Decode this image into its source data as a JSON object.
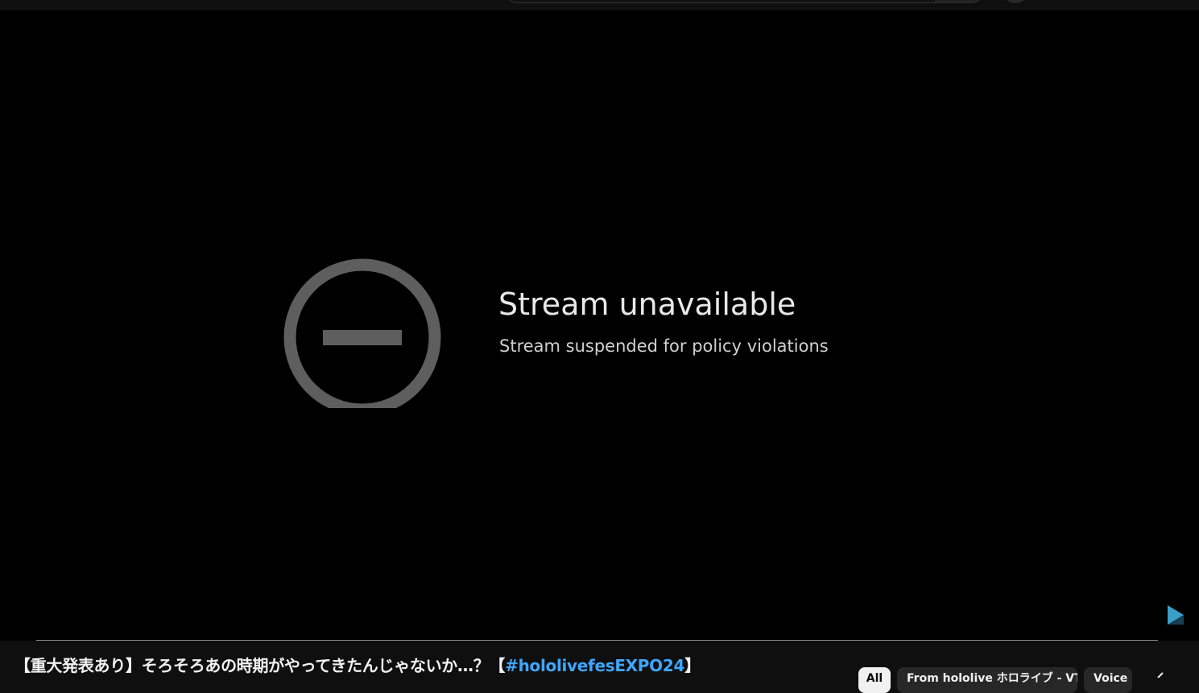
{
  "player": {
    "error_title": "Stream unavailable",
    "error_message": "Stream suspended for policy violations",
    "error_icon": "do-not-enter-icon"
  },
  "video": {
    "title_prefix": "【重大発表あり】そろそろあの時期がやってきたんじゃないか…？【",
    "title_hashtag": "#hololivefesEXPO24",
    "title_suffix": "】"
  },
  "chips": {
    "all": "All",
    "from": "From hololive ホロライブ - VT...",
    "voice": "Voice"
  },
  "colors": {
    "hashtag": "#3ea6ff",
    "player_background": "#000000",
    "page_background": "#0f0f0f"
  }
}
